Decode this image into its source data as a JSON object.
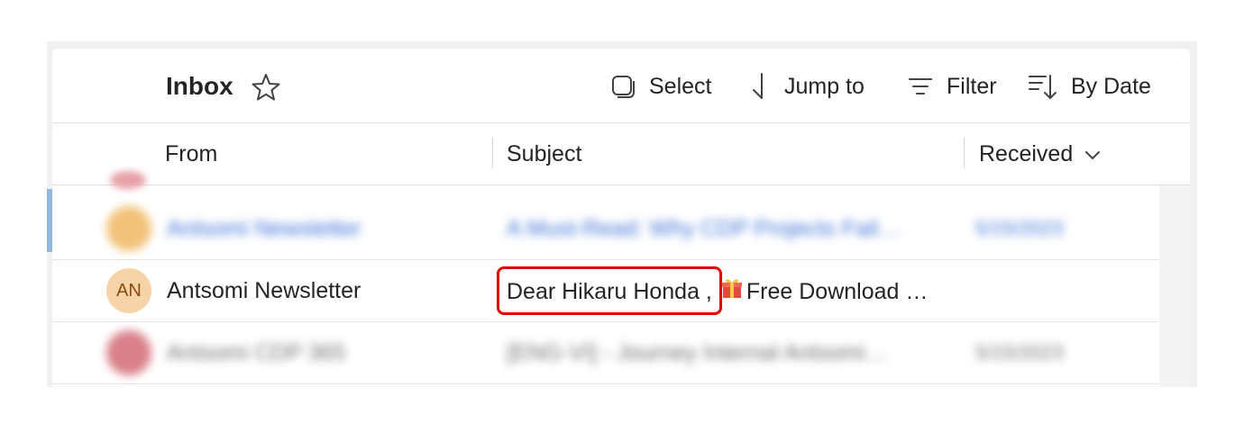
{
  "toolbar": {
    "title": "Inbox",
    "select_label": "Select",
    "jump_label": "Jump to",
    "filter_label": "Filter",
    "sort_label": "By Date"
  },
  "columns": {
    "from": "From",
    "subject": "Subject",
    "received": "Received"
  },
  "rows": [
    {
      "avatar": "",
      "from": "Antsomi Newsletter",
      "subject": "A Must-Read: Why CDP Projects Fail…",
      "received": "5/15/2023",
      "blurred": true,
      "avatar_color": "#f2c27a"
    },
    {
      "avatar": "AN",
      "from": "Antsomi Newsletter",
      "subject_highlight": "Dear Hikaru Honda ,",
      "subject_rest": "Free Download …",
      "received": "",
      "blurred": false,
      "avatar_color": "#f7d3a8"
    },
    {
      "avatar": "",
      "from": "Antsomi CDP 365",
      "subject": "[ENG-VI] - Journey Internal Antsomi…",
      "received": "5/15/2023",
      "blurred": true,
      "avatar_color": "#d9808a"
    }
  ],
  "colors": {
    "highlight_border": "#e00000",
    "avatar_text": "#8a4a12"
  },
  "icons": {
    "favorite": "star-icon",
    "select": "select-checkbox-icon",
    "jump": "arrow-down-icon",
    "filter": "filter-icon",
    "sort": "sort-icon",
    "received_sort": "chevron-down-icon",
    "gift": "gift-icon"
  }
}
